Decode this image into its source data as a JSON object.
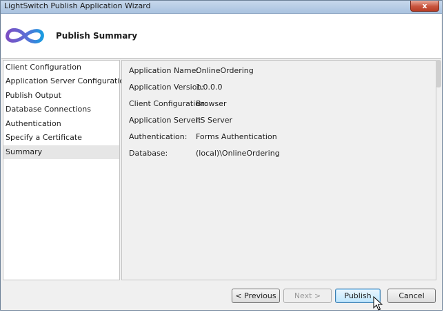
{
  "window": {
    "title": "LightSwitch Publish Application Wizard",
    "close_glyph": "x"
  },
  "header": {
    "logo_icon": "infinity-logo-icon",
    "title": "Publish Summary"
  },
  "sidebar": {
    "items": [
      {
        "label": "Client Configuration"
      },
      {
        "label": "Application Server Configuration"
      },
      {
        "label": "Publish Output"
      },
      {
        "label": "Database Connections"
      },
      {
        "label": "Authentication"
      },
      {
        "label": "Specify a Certificate"
      },
      {
        "label": "Summary",
        "selected": true
      }
    ]
  },
  "summary": {
    "rows": [
      {
        "label": "Application Name:",
        "value": "OnlineOrdering"
      },
      {
        "label": "Application Version:",
        "value": "1.0.0.0"
      },
      {
        "label": "Client Configuration:",
        "value": "Browser"
      },
      {
        "label": "Application Server:",
        "value": "IIS Server"
      },
      {
        "label": "Authentication:",
        "value": "Forms Authentication"
      },
      {
        "label": "Database:",
        "value": "(local)\\OnlineOrdering"
      }
    ]
  },
  "buttons": {
    "previous": "< Previous",
    "next": "Next >",
    "publish": "Publish",
    "cancel": "Cancel"
  },
  "colors": {
    "logo_purple": "#7b4fc4",
    "logo_blue": "#1a9be0",
    "selected_item_bg": "#e6e6e6",
    "default_button_border": "#3c7fb1"
  }
}
